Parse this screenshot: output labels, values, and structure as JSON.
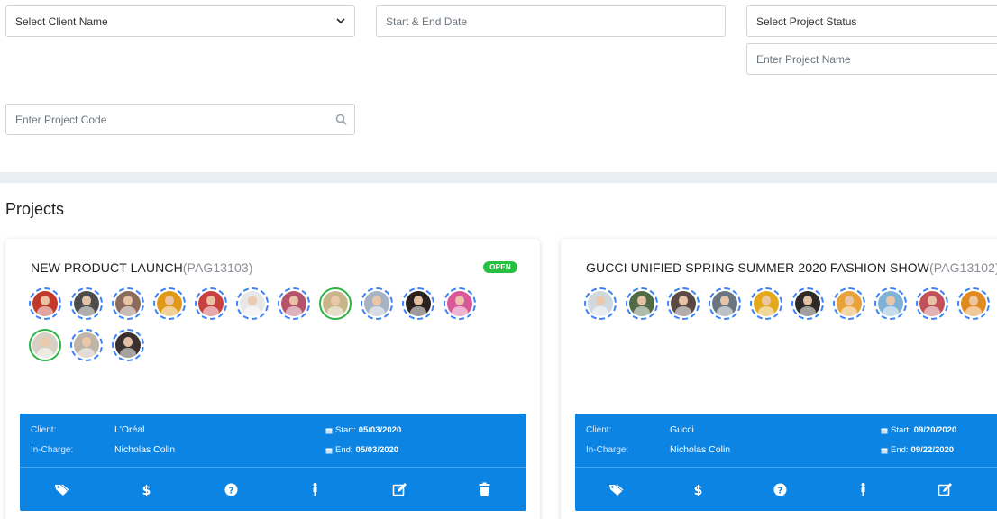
{
  "filters": {
    "client_placeholder": "Select Client Name",
    "date_placeholder": "Start & End Date",
    "status_placeholder": "Select Project Status",
    "name_placeholder": "Enter Project Name",
    "code_placeholder": "Enter Project Code"
  },
  "section_title": "Projects",
  "labels": {
    "client": "Client:",
    "in_charge": "In-Charge:",
    "start": "Start:",
    "end": "End:"
  },
  "projects": [
    {
      "title": "NEW PRODUCT LAUNCH",
      "code": "(PAG13103)",
      "status": "OPEN",
      "status_color": "#28c041",
      "client": "L'Oréal",
      "in_charge": "Nicholas Colin",
      "start": "05/03/2020",
      "end": "05/03/2020",
      "actions": [
        "tag-icon",
        "dollar-icon",
        "question-icon",
        "person-icon",
        "edit-icon",
        "trash-icon"
      ],
      "avatars": [
        {
          "bg": "#c0392b",
          "border": "dashed"
        },
        {
          "bg": "#4d4d4d",
          "border": "dashed"
        },
        {
          "bg": "#8a6b5c",
          "border": "dashed"
        },
        {
          "bg": "#e09a1a",
          "border": "dashed"
        },
        {
          "bg": "#c94040",
          "border": "dashed"
        },
        {
          "bg": "#e8e8e8",
          "border": "dashed"
        },
        {
          "bg": "#b5536a",
          "border": "dashed"
        },
        {
          "bg": "#c9b58a",
          "border": "solid"
        },
        {
          "bg": "#a7b3c2",
          "border": "dashed"
        },
        {
          "bg": "#2b2220",
          "border": "dashed"
        },
        {
          "bg": "#d9589a",
          "border": "dashed"
        },
        {
          "bg": "#d8d0c4",
          "border": "solid"
        },
        {
          "bg": "#bfb5a7",
          "border": "dashed"
        },
        {
          "bg": "#3a3030",
          "border": "dashed"
        }
      ]
    },
    {
      "title": "GUCCI UNIFIED SPRING SUMMER 2020 FASHION SHOW",
      "code": "(PAG13102)",
      "status": "",
      "status_color": "#28c041",
      "client": "Gucci",
      "in_charge": "Nicholas Colin",
      "start": "09/20/2020",
      "end": "09/22/2020",
      "actions": [
        "tag-icon",
        "dollar-icon",
        "question-icon",
        "person-icon",
        "edit-icon"
      ],
      "avatars": [
        {
          "bg": "#cfd8dc",
          "border": "dashed"
        },
        {
          "bg": "#4f6a45",
          "border": "dashed"
        },
        {
          "bg": "#5a4a45",
          "border": "dashed"
        },
        {
          "bg": "#6b7580",
          "border": "dashed"
        },
        {
          "bg": "#e2a91c",
          "border": "dashed"
        },
        {
          "bg": "#2f2a28",
          "border": "dashed"
        },
        {
          "bg": "#e7a23a",
          "border": "dashed"
        },
        {
          "bg": "#7fb2d6",
          "border": "dashed"
        },
        {
          "bg": "#c2505a",
          "border": "dashed"
        },
        {
          "bg": "#e08a20",
          "border": "dashed"
        },
        {
          "bg": "#d32f2f",
          "border": "solid-red"
        }
      ]
    }
  ]
}
